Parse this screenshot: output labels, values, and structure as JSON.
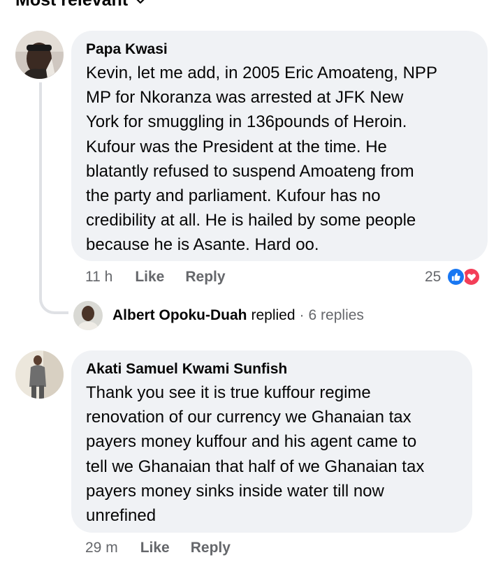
{
  "header": {
    "sort_label": "Most relevant"
  },
  "comments": [
    {
      "author": "Papa Kwasi",
      "text": "Kevin, let me add, in 2005 Eric Amoateng, NPP\nMP for Nkoranza was arrested at JFK New\nYork for smuggling in 136pounds of Heroin.\nKufour was the President at the time. He\nblatantly refused to suspend Amoateng from\nthe party and parliament. Kufour has no\ncredibility at all. He is hailed by some people\nbecause he is Asante. Hard oo.",
      "time": "11 h",
      "like_label": "Like",
      "reply_label": "Reply",
      "reaction_count": "25",
      "reactions": [
        "like-icon",
        "love-icon"
      ],
      "reply_summary": {
        "name": "Albert Opoku-Duah",
        "verb": "replied",
        "separator": "·",
        "count": "6 replies"
      }
    },
    {
      "author": "Akati Samuel Kwami Sunfish",
      "text": "Thank you see it is true kuffour regime\nrenovation of our currency we Ghanaian tax\npayers money kuffour and his agent came to\ntell we Ghanaian that half of we Ghanaian tax\npayers money sinks inside water till now\nunrefined",
      "time": "29 m",
      "like_label": "Like",
      "reply_label": "Reply"
    }
  ],
  "colors": {
    "bubble": "#f0f2f5",
    "meta": "#65676b",
    "like_blue": "#1877f2",
    "love_red": "#f33e58"
  }
}
